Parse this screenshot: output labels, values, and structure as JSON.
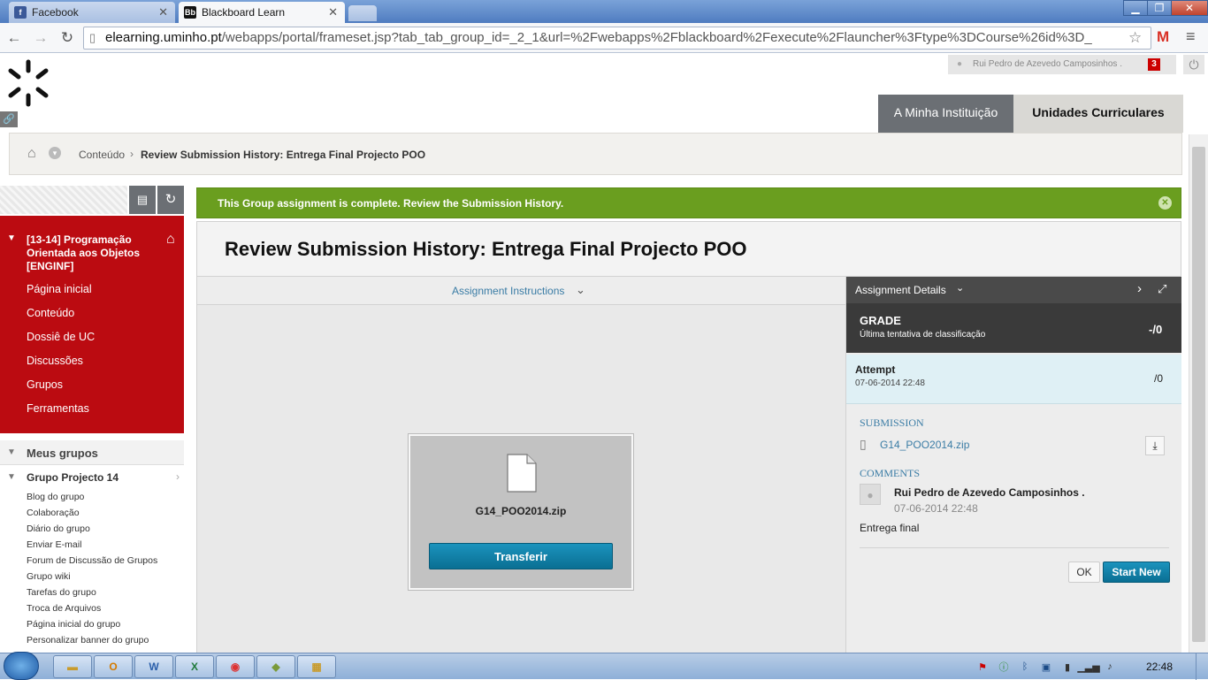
{
  "browser": {
    "tabs": [
      {
        "title": "Facebook",
        "favicon": "facebook-icon"
      },
      {
        "title": "Blackboard Learn",
        "favicon": "blackboard-icon"
      }
    ],
    "url_domain": "elearning.uminho.pt",
    "url_path": "/webapps/portal/frameset.jsp?tab_tab_group_id=_2_1&url=%2Fwebapps%2Fblackboard%2Fexecute%2Flauncher%3Ftype%3DCourse%26id%3D_"
  },
  "header": {
    "user_name": "Rui Pedro de Azevedo Camposinhos .",
    "notification_count": "3",
    "tabs": [
      {
        "label": "A Minha Instituição",
        "active": false
      },
      {
        "label": "Unidades Curriculares",
        "active": true
      }
    ]
  },
  "breadcrumb": {
    "items": [
      "Conteúdo",
      "Review Submission History: Entrega Final Projecto POO"
    ]
  },
  "course_menu": {
    "course_title": "[13-14] Programação Orientada aos Objetos [ENGINF]",
    "items": [
      "Página inicial",
      "Conteúdo",
      "Dossiê de UC",
      "Discussões",
      "Grupos",
      "Ferramentas"
    ]
  },
  "groups": {
    "section_title": "Meus grupos",
    "group_name": "Grupo Projecto 14",
    "links": [
      "Blog do grupo",
      "Colaboração",
      "Diário do grupo",
      "Enviar E-mail",
      "Forum de Discussão de Grupos",
      "Grupo wiki",
      "Tarefas do grupo",
      "Troca de Arquivos",
      "Página inicial do grupo",
      "Personalizar banner do grupo"
    ]
  },
  "alert": {
    "message": "This Group assignment is complete. Review the Submission History."
  },
  "page": {
    "title": "Review Submission History: Entrega Final Projecto POO",
    "instructions_label": "Assignment Instructions",
    "file_name": "G14_POO2014.zip",
    "download_label": "Transferir"
  },
  "details": {
    "header": "Assignment Details",
    "grade_label": "GRADE",
    "grade_sub": "Última tentativa de classificação",
    "grade_value": "-/0",
    "attempt_label": "Attempt",
    "attempt_date": "07-06-2014 22:48",
    "attempt_value": "/0",
    "submission_label": "SUBMISSION",
    "submission_file": "G14_POO2014.zip",
    "comments_label": "COMMENTS",
    "comment_author": "Rui Pedro de Azevedo Camposinhos .",
    "comment_date": "07-06-2014 22:48",
    "comment_text": "Entrega final",
    "ok_label": "OK",
    "start_new_label": "Start New"
  },
  "taskbar": {
    "clock": "22:48"
  },
  "colors": {
    "course_menu_bg": "#bb0b11",
    "alert_bg": "#6a9e1f",
    "button_blue": "#0e7fa6"
  }
}
